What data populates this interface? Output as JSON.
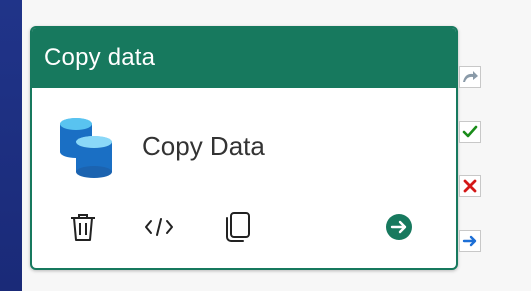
{
  "activity": {
    "header_title": "Copy data",
    "name": "Copy Data"
  },
  "actions": {
    "delete": "delete-icon",
    "code": "code-icon",
    "copy": "copy-icon",
    "go": "arrow-right-circle-icon"
  },
  "handles": {
    "skip": "skip-arrow-icon",
    "success": "checkmark-icon",
    "fail": "x-icon",
    "complete": "arrow-right-icon"
  },
  "colors": {
    "header": "#17795e",
    "success": "#1a8c1a",
    "fail": "#d41818",
    "complete": "#1d6fd6",
    "skip": "#8a9aa8",
    "db_icon": "#1a6fc4"
  }
}
